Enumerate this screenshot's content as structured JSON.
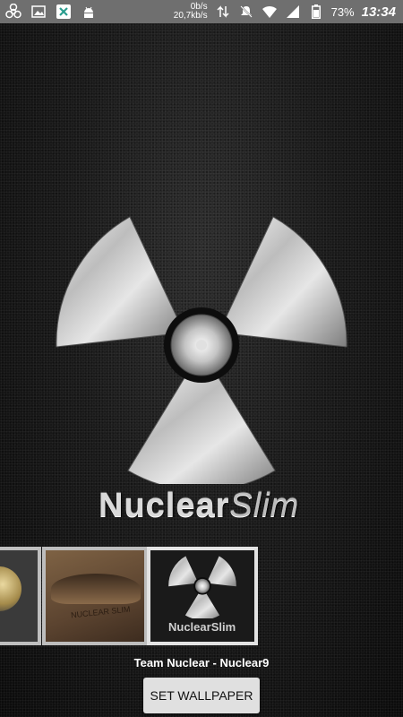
{
  "status_bar": {
    "speed_up": "0b/s",
    "speed_down": "20,7kb/s",
    "battery_percent": "73%",
    "time": "13:34",
    "left_icons": [
      "biohazard-icon",
      "image-icon",
      "x-app-icon",
      "android-icon"
    ],
    "right_icons": [
      "data-arrows-icon",
      "mute-icon",
      "wifi-icon",
      "signal-icon",
      "battery-icon"
    ]
  },
  "wallpaper": {
    "logo_word_1": "Nuclear",
    "logo_word_2": "Slim",
    "icon": "radiation-icon"
  },
  "thumbnails": [
    {
      "name": "gold-theme-thumbnail"
    },
    {
      "name": "leather-theme-thumbnail",
      "label": "NUCLEAR SLIM"
    },
    {
      "name": "nuclear-slim-thumbnail",
      "label": "NuclearSlim",
      "selected": true
    }
  ],
  "caption": "Team Nuclear - Nuclear9",
  "set_button_label": "SET WALLPAPER"
}
